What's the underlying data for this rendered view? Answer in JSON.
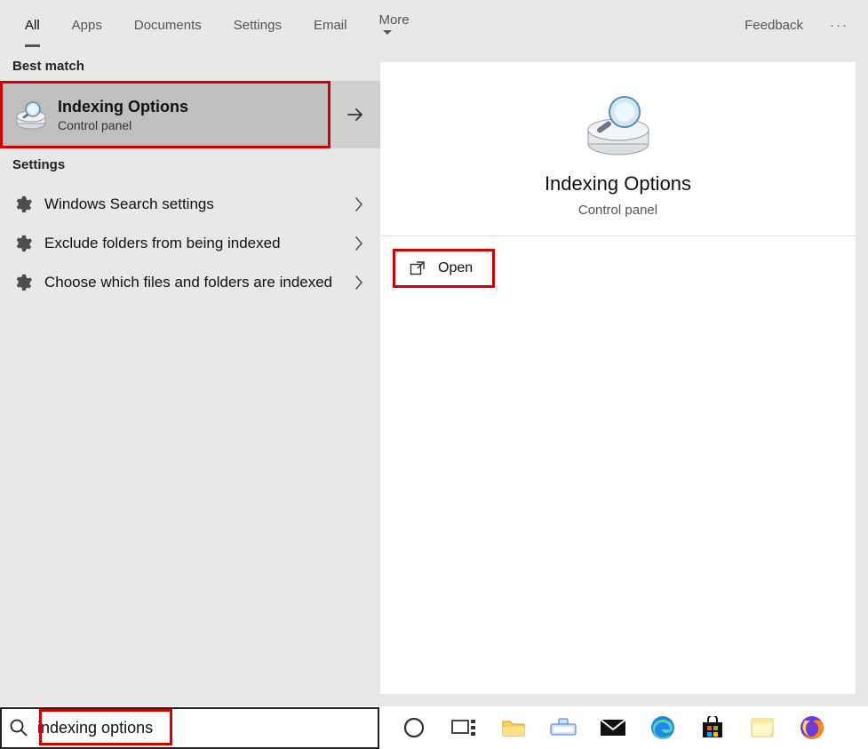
{
  "header": {
    "tabs": [
      {
        "label": "All",
        "active": true
      },
      {
        "label": "Apps",
        "active": false
      },
      {
        "label": "Documents",
        "active": false
      },
      {
        "label": "Settings",
        "active": false
      },
      {
        "label": "Email",
        "active": false
      },
      {
        "label": "More",
        "active": false,
        "dropdown": true
      }
    ],
    "feedback_label": "Feedback"
  },
  "best_match_section_label": "Best match",
  "best_match": {
    "title": "Indexing Options",
    "subtitle": "Control panel"
  },
  "settings_section_label": "Settings",
  "settings_items": [
    {
      "label": "Windows Search settings"
    },
    {
      "label": "Exclude folders from being indexed"
    },
    {
      "label": "Choose which files and folders are indexed"
    }
  ],
  "preview": {
    "title": "Indexing Options",
    "subtitle": "Control panel",
    "open_label": "Open"
  },
  "search": {
    "value": "indexing options"
  }
}
